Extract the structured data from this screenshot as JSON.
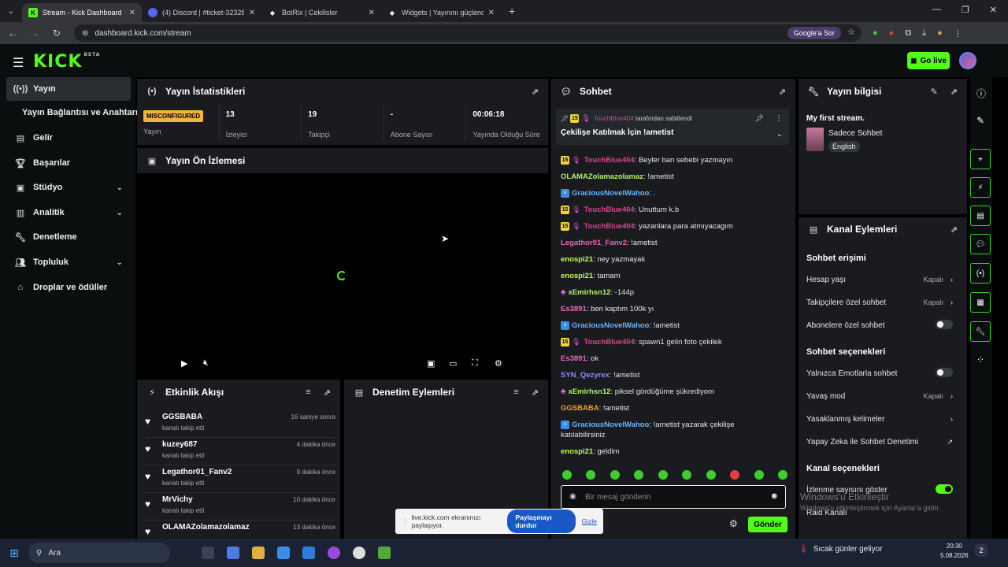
{
  "browser": {
    "tabs": [
      {
        "title": "Stream - Kick Dashboard",
        "active": true,
        "favicon": "kick-icon"
      },
      {
        "title": "(4) Discord | #ticket-32328 | Oh",
        "active": false,
        "favicon": "discord-icon"
      },
      {
        "title": "BotRix | Cekilisler",
        "active": false,
        "favicon": "botrix-icon"
      },
      {
        "title": "Widgets | Yayınını güçlendirme",
        "active": false,
        "favicon": "widgets-icon"
      }
    ],
    "url": "dashboard.kick.com/stream",
    "google_pill": "Google'a Sor"
  },
  "header": {
    "logo": "KICK",
    "logo_sup": "BETA",
    "go_live": "Go live"
  },
  "sidebar": {
    "items": [
      {
        "label": "Yayın",
        "icon": "broadcast-icon",
        "active": true
      },
      {
        "label": "Gelir",
        "icon": "revenue-icon"
      },
      {
        "label": "Başarılar",
        "icon": "trophy-icon"
      },
      {
        "label": "Stüdyo",
        "icon": "studio-icon",
        "expand": true
      },
      {
        "label": "Analitik",
        "icon": "analytics-icon",
        "expand": true
      },
      {
        "label": "Denetleme",
        "icon": "moderation-icon"
      },
      {
        "label": "Topluluk",
        "icon": "community-icon",
        "expand": true
      },
      {
        "label": "Droplar ve ödüller",
        "icon": "drops-icon"
      }
    ],
    "sub_item": "Yayın Bağlantısı ve Anahtarı"
  },
  "stats_panel": {
    "title": "Yayın İstatistikleri",
    "stats": [
      {
        "value": "MISCONFIGURED",
        "label": "Yayın"
      },
      {
        "value": "13",
        "label": "İzleyici"
      },
      {
        "value": "19",
        "label": "Takipçi"
      },
      {
        "value": "-",
        "label": "Abone Sayısı"
      },
      {
        "value": "00:06:18",
        "label": "Yayında Olduğu Süre"
      }
    ]
  },
  "preview_panel": {
    "title": "Yayın Ön İzlemesi"
  },
  "activity_panel": {
    "title": "Etkinlik Akışı",
    "items": [
      {
        "name": "GGSBABA",
        "sub": "kanalı takip etti",
        "time": "16 saniye sonra"
      },
      {
        "name": "kuzey687",
        "sub": "kanalı takip etti",
        "time": "4 dakika önce"
      },
      {
        "name": "Legathor01_Fanv2",
        "sub": "kanalı takip etti",
        "time": "9 dakika önce"
      },
      {
        "name": "MrVichy",
        "sub": "kanalı takip etti",
        "time": "10 dakika önce"
      },
      {
        "name": "OLAMAZolamazolamaz",
        "sub": "",
        "time": "13 dakika önce"
      }
    ]
  },
  "mod_panel": {
    "title": "Denetim Eylemleri"
  },
  "chat": {
    "title": "Sohbet",
    "pinned_by_user": "TouchBlue404",
    "pinned_by_suffix": "tarafından sabitlendi",
    "pinned_text": "Çekilişe Katılmak İçin !ametist",
    "messages": [
      {
        "badge": "15",
        "mic": true,
        "user": "TouchBlue404",
        "color": "#d14a8c",
        "text": "Beyler ban sebebi yazmayın"
      },
      {
        "user": "OLAMAZolamazolamaz",
        "color": "#b6f266",
        "text": "!ametist"
      },
      {
        "kb": true,
        "user": "GraciousNovelWahoo",
        "color": "#6ab6ff",
        "text": "."
      },
      {
        "badge": "15",
        "mic": true,
        "user": "TouchBlue404",
        "color": "#d14a8c",
        "text": "Unuttum k.b"
      },
      {
        "badge": "15",
        "mic": true,
        "user": "TouchBlue404",
        "color": "#d14a8c",
        "text": "yazanlara para atmıyacagım"
      },
      {
        "user": "Legathor01_Fanv2",
        "color": "#e56ab6",
        "text": "!ametist"
      },
      {
        "user": "enospi21",
        "color": "#c7f55a",
        "text": "ney yazmayak"
      },
      {
        "user": "enospi21",
        "color": "#c7f55a",
        "text": "tamam"
      },
      {
        "pk": true,
        "user": "xEmirhsn12",
        "color": "#b6f266",
        "text": "-144p"
      },
      {
        "user": "Es3891",
        "color": "#e56ab6",
        "text": "ben kaptım 100k yı"
      },
      {
        "kb": true,
        "user": "GraciousNovelWahoo",
        "color": "#6ab6ff",
        "text": "!ametist"
      },
      {
        "badge": "15",
        "mic": true,
        "user": "TouchBlue404",
        "color": "#d14a8c",
        "text": "spawn1 gelin foto çekilek"
      },
      {
        "user": "Es3891",
        "color": "#e56ab6",
        "text": "ok"
      },
      {
        "user": "SYN_Qezyrex",
        "color": "#8d8dff",
        "text": "!ametist"
      },
      {
        "pk": true,
        "user": "xEmirhsn12",
        "color": "#b6f266",
        "text": "piksel gördüğüme şükrediyom"
      },
      {
        "user": "GGSBABA",
        "color": "#f0a030",
        "text": "!ametist"
      },
      {
        "kb": true,
        "user": "GraciousNovelWahoo",
        "color": "#6ab6ff",
        "text": "!ametist yazarak çekilişe"
      },
      {
        "user": "",
        "color": "#e6e6e6",
        "text": "katılabilirsiniz"
      },
      {
        "user": "enospi21",
        "color": "#c7f55a",
        "text": "geldim"
      }
    ],
    "input_placeholder": "Bir mesaj gönderin",
    "send": "Gönder"
  },
  "stream_info": {
    "title": "Yayın bilgisi",
    "stream_title": "My first stream.",
    "category": "Sadece Sohbet",
    "language": "English"
  },
  "channel_actions": {
    "title": "Kanal Eylemleri",
    "chat_access": "Sohbet erişimi",
    "account_age": {
      "label": "Hesap yaşı",
      "value": "Kapalı"
    },
    "followers_only": {
      "label": "Takipçilere özel sohbet",
      "value": "Kapalı"
    },
    "subs_only": "Abonelere özel sohbet",
    "chat_options": "Sohbet seçenekleri",
    "emote_only": "Yalnızca Emotlarla sohbet",
    "slow_mode": {
      "label": "Yavaş mod",
      "value": "Kapalı"
    },
    "banned_words": "Yasaklanmış kelimeler",
    "ai_mod": "Yapay Zeka ile Sohbet Denetimi",
    "channel_options": "Kanal seçenekleri",
    "show_viewers": "İzlenme sayısını göster",
    "raid": "Raid Kanalı"
  },
  "share_bar": {
    "text": "live.kick.com ekranınızı paylaşıyor.",
    "stop": "Paylaşmayı durdur",
    "hide": "Gizle"
  },
  "watermark": {
    "line1": "Windows'u Etkinleştir",
    "line2": "Windows'u etkinleştirmek için Ayarlar'a gidin."
  },
  "taskbar": {
    "search": "Ara",
    "weather": "Sıcak günler geliyor",
    "time": "20:30",
    "date": "5.08.2026",
    "notif": "2"
  },
  "colors": {
    "accent": "#53fc18",
    "panel": "#191b1f",
    "bg": "#000000"
  }
}
